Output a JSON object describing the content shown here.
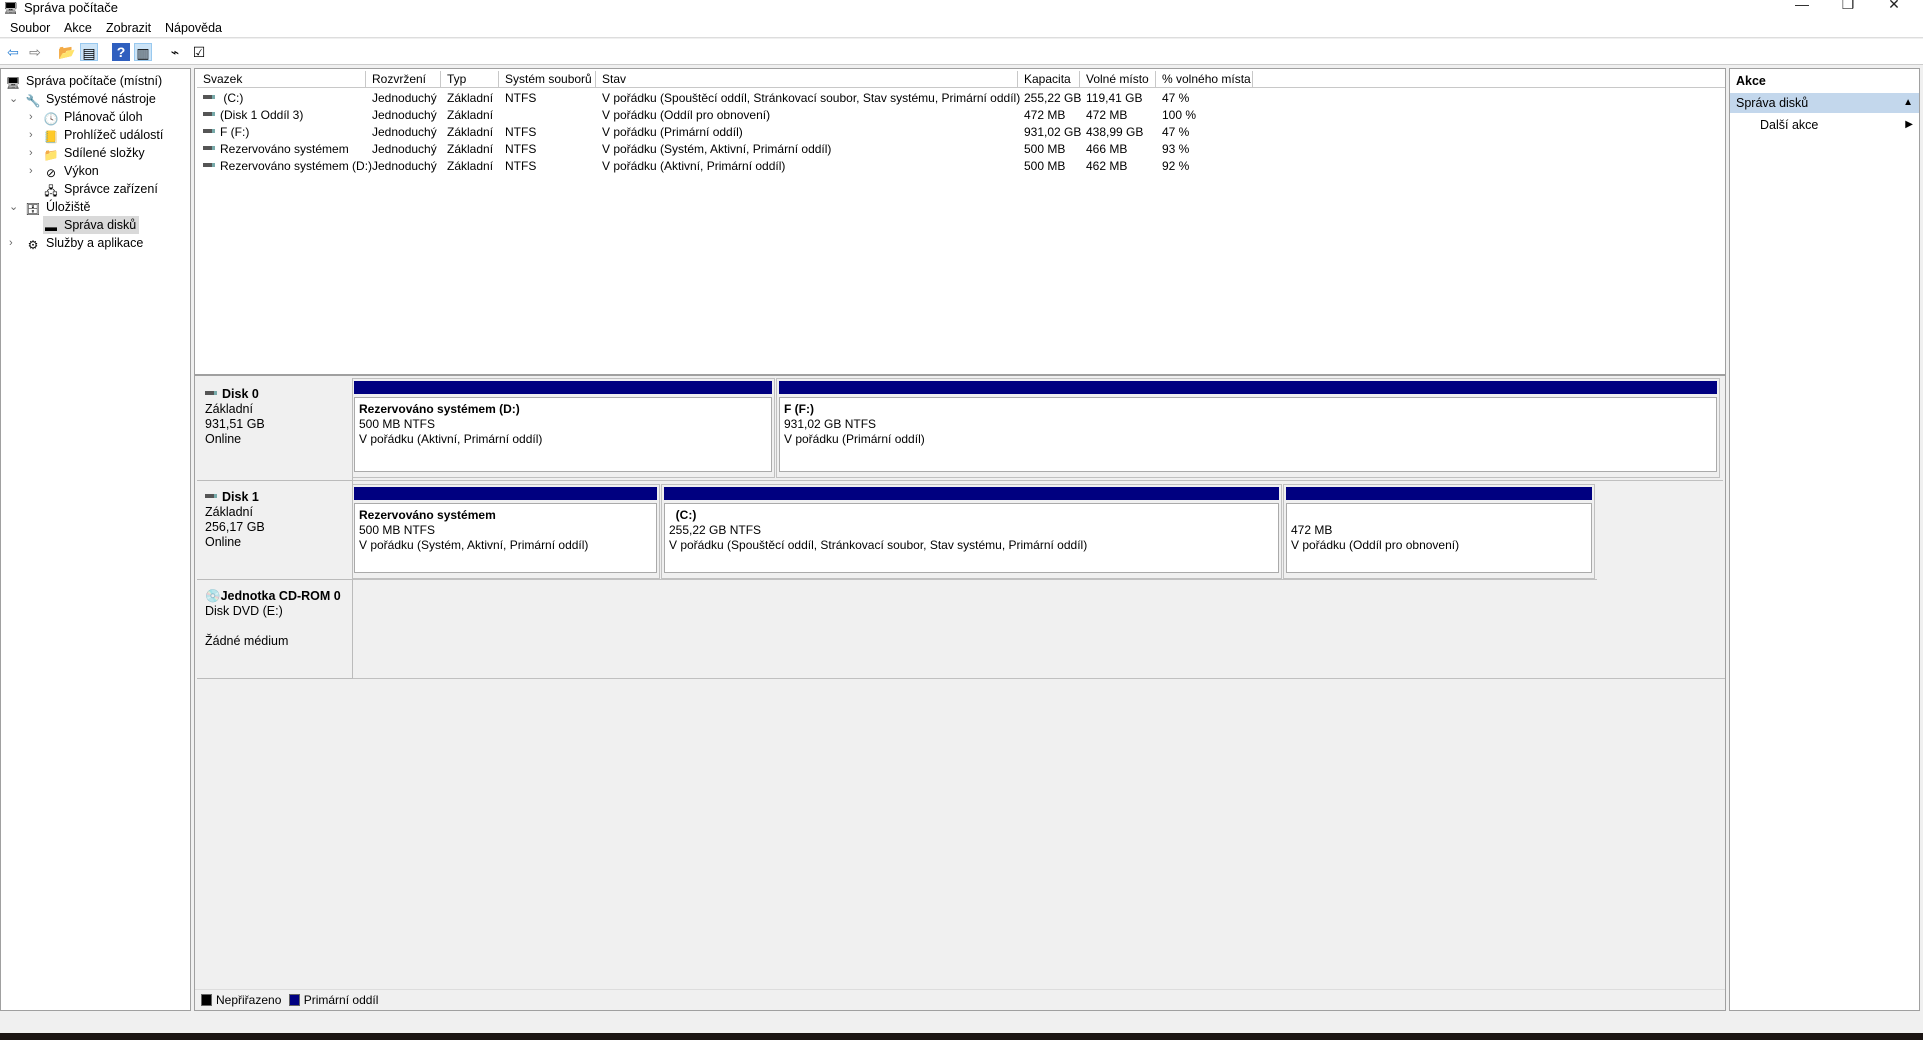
{
  "window": {
    "title": "Správa počítače",
    "minimize": "—",
    "restore": "❐",
    "close": "✕"
  },
  "menu": [
    "Soubor",
    "Akce",
    "Zobrazit",
    "Nápověda"
  ],
  "toolbar": [
    {
      "icon": "back-arrow-icon",
      "glyph": "⇦"
    },
    {
      "icon": "forward-arrow-icon",
      "glyph": "⇨"
    },
    {
      "icon": "up-folder-icon",
      "glyph": "📂"
    },
    {
      "icon": "show-hide-console-tree-icon",
      "glyph": "▤"
    },
    {
      "icon": "help-icon",
      "glyph": "?"
    },
    {
      "icon": "show-hide-action-pane-icon",
      "glyph": "▥"
    },
    {
      "icon": "connect-drive-icon",
      "glyph": "⌁"
    },
    {
      "icon": "properties-list-icon",
      "glyph": "☑"
    }
  ],
  "tree": {
    "root": "Správa počítače (místní)",
    "system_tools": "Systémové nástroje",
    "task_scheduler": "Plánovač úloh",
    "event_viewer": "Prohlížeč událostí",
    "shared_folders": "Sdílené složky",
    "performance": "Výkon",
    "device_manager": "Správce zařízení",
    "storage": "Úložiště",
    "disk_management": "Správa disků",
    "services_apps": "Služby a aplikace"
  },
  "table": {
    "columns": [
      "Svazek",
      "Rozvržení",
      "Typ",
      "Systém souborů",
      "Stav",
      "Kapacita",
      "Volné místo",
      "% volného místa"
    ],
    "rows": [
      [
        " (C:)",
        "Jednoduchý",
        "Základní",
        "NTFS",
        "V pořádku (Spouštěcí oddíl, Stránkovací soubor, Stav systému, Primární oddíl)",
        "255,22 GB",
        "119,41 GB",
        "47 %"
      ],
      [
        "(Disk 1 Oddíl 3)",
        "Jednoduchý",
        "Základní",
        "",
        "V pořádku (Oddíl pro obnovení)",
        "472 MB",
        "472 MB",
        "100 %"
      ],
      [
        "F (F:)",
        "Jednoduchý",
        "Základní",
        "NTFS",
        "V pořádku (Primární oddíl)",
        "931,02 GB",
        "438,99 GB",
        "47 %"
      ],
      [
        "Rezervováno systémem",
        "Jednoduchý",
        "Základní",
        "NTFS",
        "V pořádku (Systém, Aktivní, Primární oddíl)",
        "500 MB",
        "466 MB",
        "93 %"
      ],
      [
        "Rezervováno systémem (D:)",
        "Jednoduchý",
        "Základní",
        "NTFS",
        "V pořádku (Aktivní, Primární oddíl)",
        "500 MB",
        "462 MB",
        "92 %"
      ]
    ]
  },
  "disks": [
    {
      "name": "Disk 0",
      "type": "Základní",
      "size": "931,51 GB",
      "status": "Online",
      "partitions": [
        {
          "title": "Rezervováno systémem  (D:)",
          "size": "500 MB NTFS",
          "state": "V pořádku (Aktivní, Primární oddíl)"
        },
        {
          "title": "F  (F:)",
          "size": "931,02 GB NTFS",
          "state": "V pořádku (Primární oddíl)"
        }
      ]
    },
    {
      "name": "Disk 1",
      "type": "Základní",
      "size": "256,17 GB",
      "status": "Online",
      "partitions": [
        {
          "title": "Rezervováno systémem",
          "size": "500 MB NTFS",
          "state": "V pořádku (Systém, Aktivní, Primární oddíl)"
        },
        {
          "title": "  (C:)",
          "size": "255,22 GB NTFS",
          "state": "V pořádku (Spouštěcí oddíl, Stránkovací soubor, Stav systému, Primární oddíl)"
        },
        {
          "title": "",
          "size": "472 MB",
          "state": "V pořádku (Oddíl pro obnovení)"
        }
      ]
    },
    {
      "name": "Jednotka CD-ROM 0",
      "type": "Disk DVD (E:)",
      "status": "Žádné médium"
    }
  ],
  "legend": [
    {
      "label": "Nepřiřazeno",
      "color": "#000000"
    },
    {
      "label": "Primární oddíl",
      "color": "#000080"
    }
  ],
  "actions": {
    "header": "Akce",
    "section": "Správa disků",
    "more": "Další akce"
  },
  "colors": {
    "primary_partition": "#000080",
    "selection": "#c3d7ec"
  }
}
